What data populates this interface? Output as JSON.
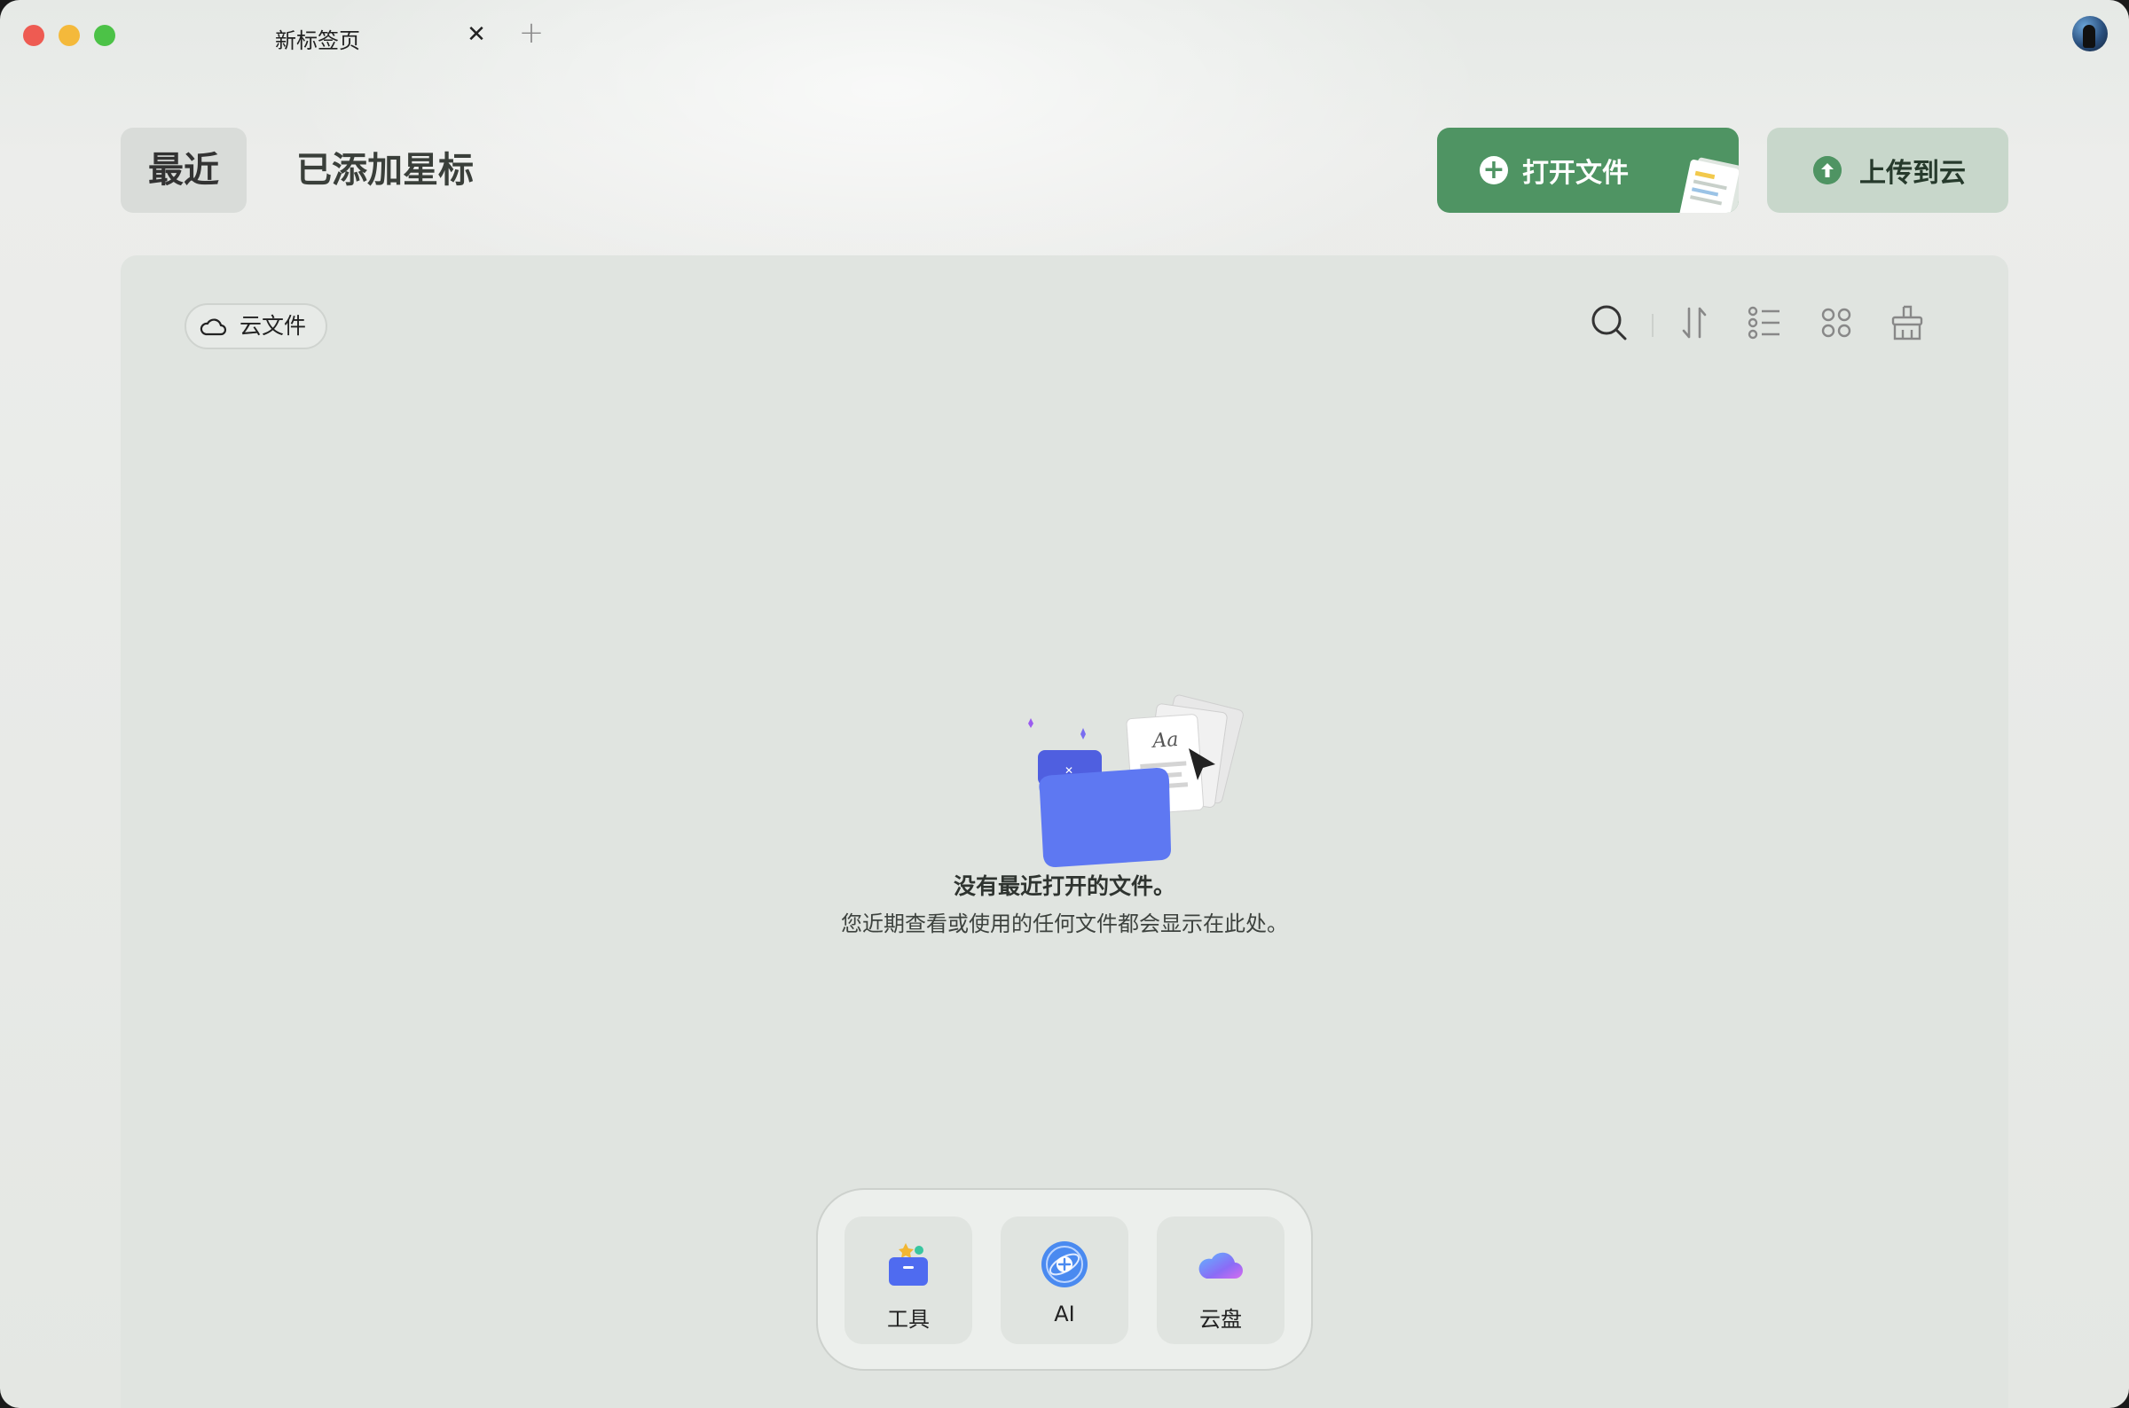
{
  "titlebar": {
    "tab_title": "新标签页",
    "tab_close_glyph": "✕",
    "new_tab_glyph": "+"
  },
  "header": {
    "segments": [
      {
        "label": "最近",
        "selected": true
      },
      {
        "label": "已添加星标",
        "selected": false
      }
    ],
    "open_file_label": "打开文件",
    "upload_label": "上传到云"
  },
  "toolbar": {
    "cloud_files_label": "云文件",
    "icons": [
      "search-icon",
      "sort-icon",
      "list-view-icon",
      "grid-view-icon",
      "clear-icon"
    ]
  },
  "empty_state": {
    "title": "没有最近打开的文件。",
    "subtitle": "您近期查看或使用的任何文件都会显示在此处。"
  },
  "dock": {
    "items": [
      {
        "label": "工具",
        "icon": "tools-icon"
      },
      {
        "label": "AI",
        "icon": "ai-icon"
      },
      {
        "label": "云盘",
        "icon": "cloud-drive-icon"
      }
    ]
  },
  "colors": {
    "accent_green": "#4f9463",
    "upload_bg": "#c8d7cb",
    "panel_bg": "#e0e4e0"
  }
}
